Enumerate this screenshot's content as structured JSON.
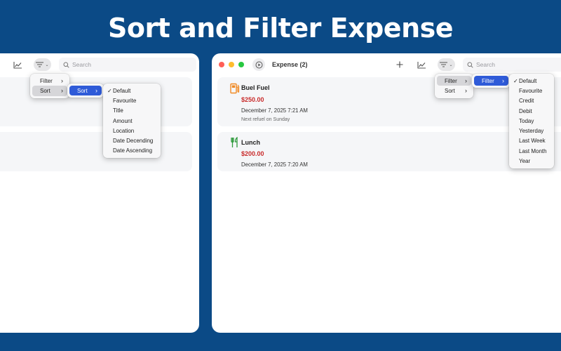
{
  "headline": "Sort and Filter Expense",
  "colors": {
    "background": "#0b4a86",
    "accent": "#2f5bd8",
    "amount": "#c92b2b",
    "fuel_icon": "#f08a24",
    "food_icon": "#2e9a3c"
  },
  "left_window": {
    "search_placeholder": "Search",
    "menu": [
      {
        "label": "Filter",
        "has_submenu": true
      },
      {
        "label": "Sort",
        "has_submenu": true,
        "highlighted": true
      }
    ],
    "submenu": [
      {
        "label": "Sort",
        "has_submenu": true,
        "selected": true
      }
    ],
    "sort_options": [
      "Default",
      "Favourite",
      "Title",
      "Amount",
      "Location",
      "Date Decending",
      "Date Ascending"
    ],
    "sort_checked": "Default"
  },
  "right_window": {
    "title": "Expense (2)",
    "search_placeholder": "Search",
    "expenses": [
      {
        "title": "Buel Fuel",
        "amount": "$250.00",
        "date": "December 7, 2025 7:21 AM",
        "note": "Next refuel on Sunday",
        "icon": "fuel-pump-icon"
      },
      {
        "title": "Lunch",
        "amount": "$200.00",
        "date": "December 7, 2025 7:20 AM",
        "note": "",
        "icon": "fork-knife-icon"
      }
    ],
    "menu": [
      {
        "label": "Filter",
        "has_submenu": true,
        "highlighted": true
      },
      {
        "label": "Sort",
        "has_submenu": true
      }
    ],
    "submenu": [
      {
        "label": "Filter",
        "has_submenu": true,
        "selected": true
      }
    ],
    "filter_options": [
      "Default",
      "Favourite",
      "Credit",
      "Debit",
      "Today",
      "Yesterday",
      "Last Week",
      "Last Month",
      "Year"
    ],
    "filter_checked": "Default"
  }
}
